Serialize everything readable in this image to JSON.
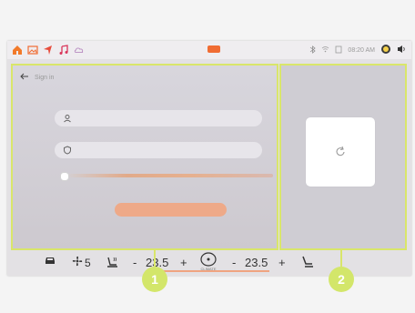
{
  "status_bar": {
    "icons": [
      "home-icon",
      "gallery-icon",
      "navigation-icon",
      "music-icon",
      "cloud-icon"
    ],
    "center_badge": "",
    "time": "08:20 AM",
    "right_icons": [
      "bluetooth-icon",
      "wifi-icon",
      "battery-icon",
      "assistant-icon",
      "volume-icon"
    ]
  },
  "left_panel": {
    "back_label": "Sign in",
    "username_placeholder": "",
    "password_placeholder": "",
    "password_link": "",
    "login_button": ""
  },
  "right_panel": {
    "qr_caption": ""
  },
  "climate_bar": {
    "fan_speed": "5",
    "left_minus": "-",
    "left_temp": "23.5",
    "left_plus": "+",
    "climate_label": "CLIMATE",
    "right_minus": "-",
    "right_temp": "23.5",
    "right_plus": "+"
  },
  "callouts": [
    "1",
    "2"
  ],
  "colors": {
    "accent": "#f1a57f",
    "outline": "#d9e66a",
    "callout": "#d3e66a"
  }
}
